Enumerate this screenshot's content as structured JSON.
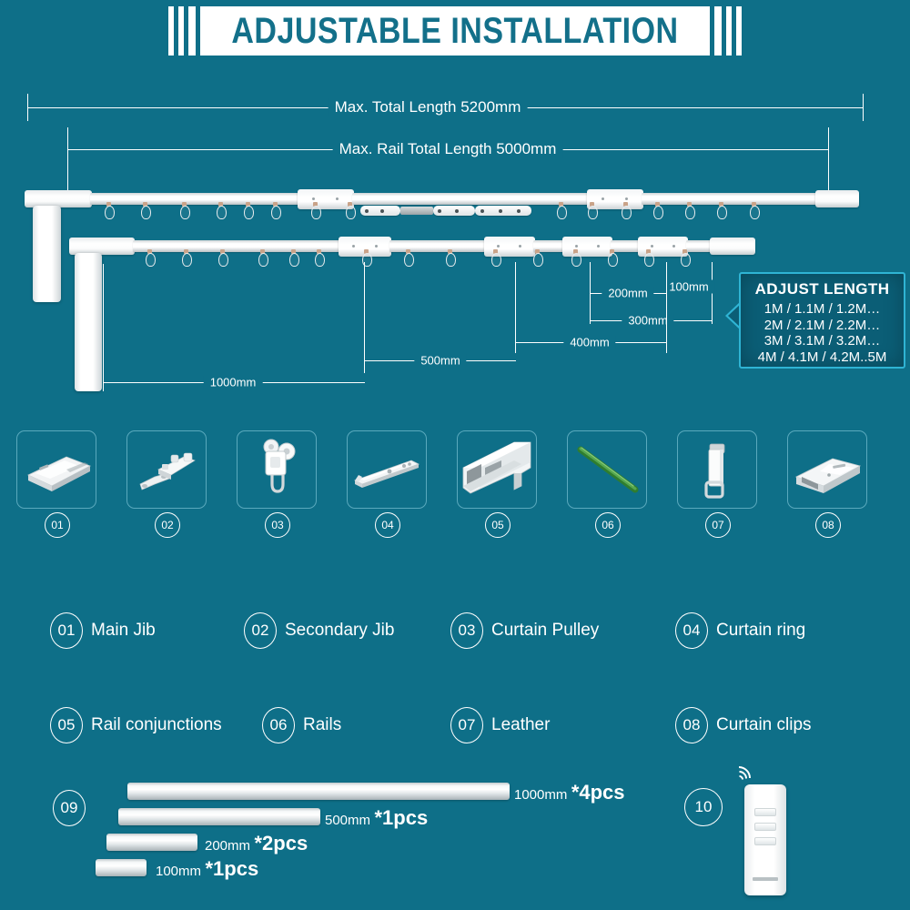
{
  "header": {
    "title": "ADJUSTABLE INSTALLATION"
  },
  "diagram": {
    "total_length_label": "Max. Total Length 5200mm",
    "rail_length_label": "Max. Rail Total Length 5000mm",
    "spacing_labels": {
      "d1000": "1000mm",
      "d500": "500mm",
      "d400": "400mm",
      "d300": "300mm",
      "d200": "200mm",
      "d100": "100mm"
    },
    "adjust_card": {
      "title": "ADJUST LENGTH",
      "line1": "1M / 1.1M / 1.2M…",
      "line2": "2M / 2.1M / 2.2M…",
      "line3": "3M / 3.1M / 3.2M…",
      "line4": "4M / 4.1M / 4.2M..5M"
    }
  },
  "parts_thumbnails": [
    {
      "num": "01",
      "icon": "main-jib-icon"
    },
    {
      "num": "02",
      "icon": "secondary-jib-icon"
    },
    {
      "num": "03",
      "icon": "curtain-pulley-icon"
    },
    {
      "num": "04",
      "icon": "curtain-ring-icon"
    },
    {
      "num": "05",
      "icon": "rail-conjunction-icon"
    },
    {
      "num": "06",
      "icon": "rails-icon"
    },
    {
      "num": "07",
      "icon": "leather-icon"
    },
    {
      "num": "08",
      "icon": "curtain-clips-icon"
    }
  ],
  "legend": {
    "row1": [
      {
        "num": "01",
        "label": "Main Jib"
      },
      {
        "num": "02",
        "label": "Secondary Jib"
      },
      {
        "num": "03",
        "label": "Curtain Pulley"
      },
      {
        "num": "04",
        "label": "Curtain ring"
      }
    ],
    "row2": [
      {
        "num": "05",
        "label": "Rail conjunctions"
      },
      {
        "num": "06",
        "label": "Rails"
      },
      {
        "num": "07",
        "label": "Leather"
      },
      {
        "num": "08",
        "label": "Curtain clips"
      }
    ]
  },
  "rails_kit": {
    "num": "09",
    "items": [
      {
        "mm": "1000mm",
        "qty": "*4pcs"
      },
      {
        "mm": "500mm",
        "qty": "*1pcs"
      },
      {
        "mm": "200mm",
        "qty": "*2pcs"
      },
      {
        "mm": "100mm",
        "qty": "*1pcs"
      }
    ]
  },
  "remote": {
    "num": "10"
  },
  "colors": {
    "background": "#0e6f88",
    "title_text": "#13708a",
    "card_border": "#2fb4d4",
    "card_fill": "#0b5e76",
    "part_box_border": "#5aa9bd"
  }
}
